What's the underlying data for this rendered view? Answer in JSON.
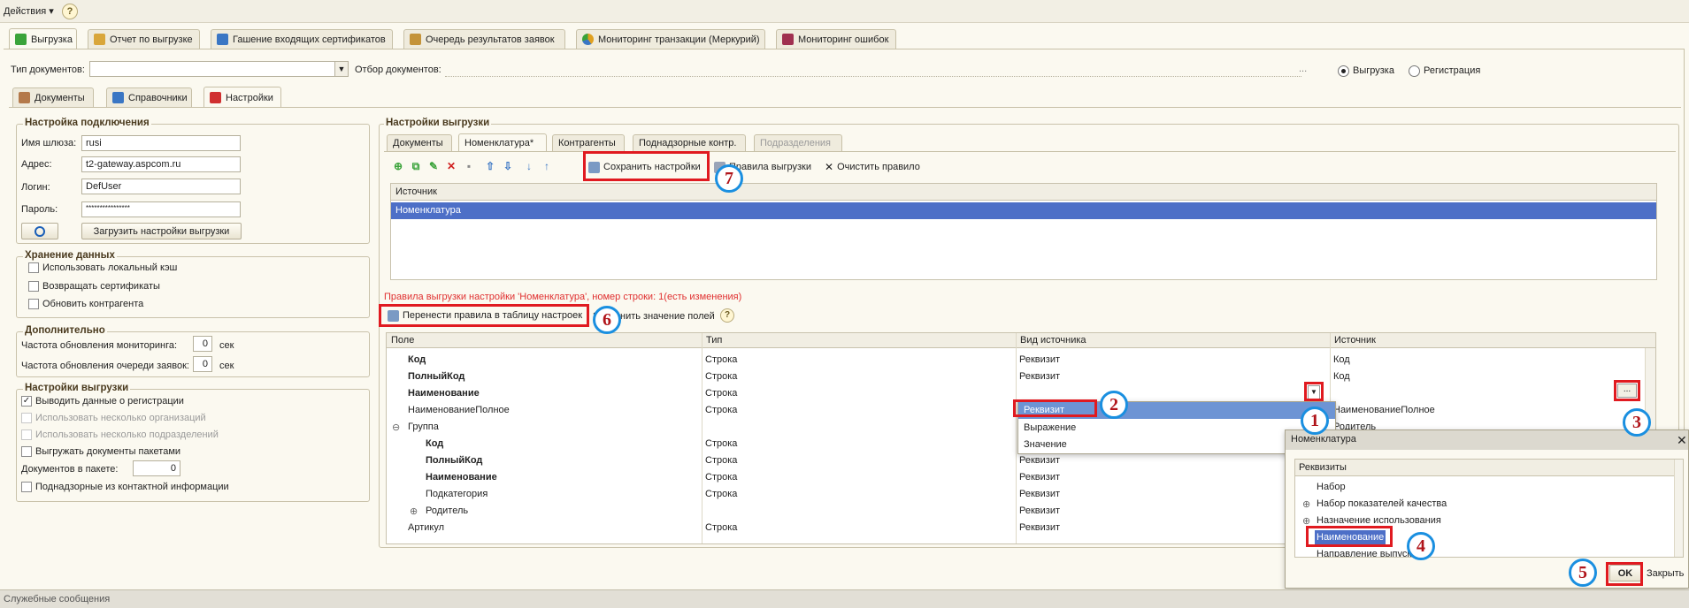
{
  "menubar": {
    "actions": "Действия ▾",
    "help": "?"
  },
  "top_tabs": [
    {
      "label": "Выгрузка",
      "icon": "export-icon",
      "color": "#3aa33a"
    },
    {
      "label": "Отчет по выгрузке",
      "icon": "report-icon",
      "color": "#d9a63a"
    },
    {
      "label": "Гашение входящих сертификатов",
      "icon": "certificate-icon",
      "color": "#3a76c4"
    },
    {
      "label": "Очередь результатов заявок",
      "icon": "queue-icon",
      "color": "#c4933a"
    },
    {
      "label": "Мониторинг транзакции (Меркурий)",
      "icon": "pie-icon",
      "color": "#e0a020"
    },
    {
      "label": "Мониторинг ошибок",
      "icon": "monitor-icon",
      "color": "#a03050"
    }
  ],
  "filter": {
    "doc_type_label": "Тип документов:",
    "doc_type_value": "",
    "doc_filter_label": "Отбор документов:",
    "doc_filter_value": "",
    "ellipsis": "...",
    "radio_export": "Выгрузка",
    "radio_register": "Регистрация"
  },
  "sub_tabs": [
    {
      "label": "Документы"
    },
    {
      "label": "Справочники"
    },
    {
      "label": "Настройки"
    }
  ],
  "connection": {
    "title": "Настройка подключения",
    "gateway_label": "Имя шлюза:",
    "gateway_value": "rusi",
    "address_label": "Адрес:",
    "address_value": "t2-gateway.aspcom.ru",
    "login_label": "Логин:",
    "login_value": "DefUser",
    "password_label": "Пароль:",
    "password_value": "****************",
    "load_button": "Загрузить настройки выгрузки"
  },
  "storage": {
    "title": "Хранение данных",
    "items": [
      "Использовать локальный кэш",
      "Возвращать сертификаты",
      "Обновить контрагента"
    ]
  },
  "extra": {
    "title": "Дополнительно",
    "monitor_label": "Частота обновления мониторинга:",
    "monitor_value": "0",
    "queue_label": "Частота обновления очереди заявок:",
    "queue_value": "0",
    "unit": "сек"
  },
  "export_settings_left": {
    "title": "Настройки выгрузки",
    "items": [
      {
        "label": "Выводить данные о регистрации",
        "checked": true,
        "disabled": false
      },
      {
        "label": "Использовать несколько организаций",
        "checked": false,
        "disabled": true
      },
      {
        "label": "Использовать несколько подразделений",
        "checked": false,
        "disabled": true
      },
      {
        "label": "Выгружать документы пакетами",
        "checked": false,
        "disabled": false
      }
    ],
    "docs_in_package_label": "Документов в пакете:",
    "docs_in_package_value": "0",
    "supervised_label": "Поднадзорные из контактной информации"
  },
  "export_right": {
    "title": "Настройки выгрузки",
    "tabs": [
      "Документы",
      "Номенклатура*",
      "Контрагенты",
      "Поднадзорные контр.",
      "Подразделения"
    ],
    "save_settings": "Сохранить настройки",
    "export_rules": "Правила выгрузки",
    "clear_rule": "Очистить правило",
    "source_header": "Источник",
    "source_rows": [
      "Номенклатура"
    ],
    "rules_caption": "Правила выгрузки настройки 'Номенклатура', номер строки: 1(есть изменения)",
    "transfer_button": "Перенести правила в таблицу настроек",
    "fill_fields": "Заполнить значение полей",
    "grid_headers": [
      "Поле",
      "Тип",
      "Вид источника",
      "Источник"
    ],
    "grid_rows": [
      {
        "field": "Код",
        "type": "Строка",
        "kind": "Реквизит",
        "source": "Код",
        "bold": true,
        "indent": 0
      },
      {
        "field": "ПолныйКод",
        "type": "Строка",
        "kind": "Реквизит",
        "source": "Код",
        "bold": true,
        "indent": 0
      },
      {
        "field": "Наименование",
        "type": "Строка",
        "kind": "",
        "source": "",
        "bold": true,
        "indent": 0
      },
      {
        "field": "НаименованиеПолное",
        "type": "Строка",
        "kind": "Реквизит",
        "source": "НаименованиеПолное",
        "bold": false,
        "indent": 0
      },
      {
        "field": "Группа",
        "type": "",
        "kind": "Выражение",
        "source": "Родитель",
        "bold": false,
        "indent": 0,
        "tree": "⊖"
      },
      {
        "field": "Код",
        "type": "Строка",
        "kind": "Значение",
        "source": "",
        "bold": true,
        "indent": 1
      },
      {
        "field": "ПолныйКод",
        "type": "Строка",
        "kind": "Реквизит",
        "source": "",
        "bold": true,
        "indent": 1
      },
      {
        "field": "Наименование",
        "type": "Строка",
        "kind": "Реквизит",
        "source": "",
        "bold": true,
        "indent": 1
      },
      {
        "field": "Подкатегория",
        "type": "Строка",
        "kind": "Реквизит",
        "source": "",
        "bold": false,
        "indent": 1
      },
      {
        "field": "Родитель",
        "type": "",
        "kind": "Реквизит",
        "source": "",
        "bold": false,
        "indent": 1,
        "tree": "⊕"
      },
      {
        "field": "Артикул",
        "type": "Строка",
        "kind": "Реквизит",
        "source": "",
        "bold": false,
        "indent": 0
      }
    ]
  },
  "dropdown": {
    "options": [
      "Реквизит",
      "Выражение",
      "Значение"
    ]
  },
  "nomenclature_popup": {
    "title": "Номенклатура",
    "header": "Реквизиты",
    "items": [
      {
        "label": "Набор",
        "tree": ""
      },
      {
        "label": "Набор показателей качества",
        "tree": "⊕"
      },
      {
        "label": "Назначение использования",
        "tree": "⊕"
      },
      {
        "label": "Наименование",
        "tree": "",
        "selected": true
      },
      {
        "label": "Направление выпуска",
        "tree": ""
      }
    ],
    "ok": "OK",
    "close": "Закрыть"
  },
  "callouts": [
    "1",
    "2",
    "3",
    "4",
    "5",
    "6",
    "7"
  ],
  "statusbar": {
    "text": "Служебные сообщения"
  },
  "colors": {
    "highlight": "#4d6fc7",
    "annotation_red": "#e01a20",
    "annotation_blue": "#1a8fe0",
    "caption_red": "#e03030"
  }
}
